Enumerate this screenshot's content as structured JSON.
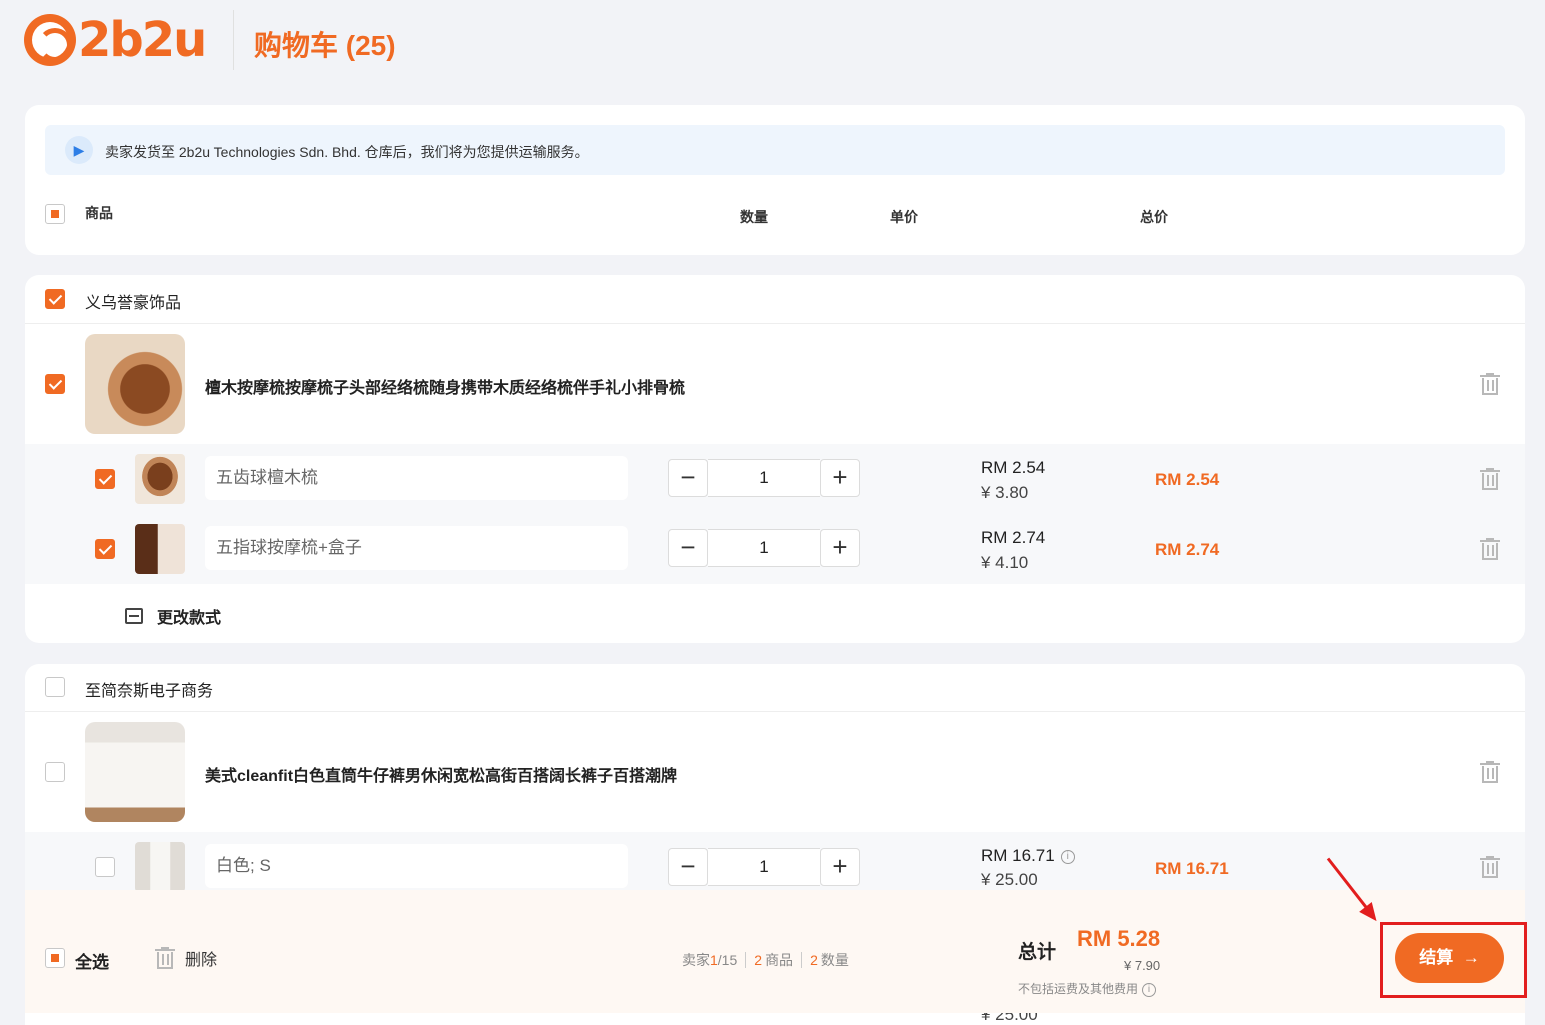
{
  "header": {
    "logo_text": "2b2u",
    "title": "购物车 (25)"
  },
  "notice": {
    "text": "卖家发货至 2b2u Technologies Sdn. Bhd. 仓库后，我们将为您提供运输服务。"
  },
  "table_headers": {
    "product": "商品",
    "quantity": "数量",
    "unit_price": "单价",
    "total": "总价"
  },
  "shops": [
    {
      "name": "义乌誉豪饰品",
      "checked": true,
      "product_title": "檀木按摩梳按摩梳子头部经络梳随身携带木质经络梳伴手礼小排骨梳",
      "skus": [
        {
          "name": "五齿球檀木梳",
          "qty": "1",
          "price_rm": "RM 2.54",
          "price_cny": "¥ 3.80",
          "total_rm": "RM 2.54",
          "checked": true
        },
        {
          "name": "五指球按摩梳+盒子",
          "qty": "1",
          "price_rm": "RM 2.74",
          "price_cny": "¥ 4.10",
          "total_rm": "RM 2.74",
          "checked": true
        }
      ],
      "change_style_label": "更改款式"
    },
    {
      "name": "至简奈斯电子商务",
      "checked": false,
      "product_title": "美式cleanfit白色直筒牛仔裤男休闲宽松高街百搭阔长裤子百搭潮牌",
      "skus": [
        {
          "name": "白色; S",
          "qty": "1",
          "price_rm": "RM 16.71",
          "price_cny": "¥ 25.00",
          "total_rm": "RM 16.71",
          "checked": false
        }
      ],
      "peek_price_cny": "¥ 25.00"
    }
  ],
  "footer": {
    "select_all": "全选",
    "delete": "删除",
    "stats": {
      "seller_label": "卖家",
      "seller_selected": "1",
      "seller_total": "/15",
      "items_count": "2",
      "items_label": "商品",
      "qty_count": "2",
      "qty_label": "数量"
    },
    "total_label": "总计",
    "total_rm": "RM 5.28",
    "total_cny": "¥ 7.90",
    "note": "不包括运费及其他费用",
    "checkout": "结算"
  },
  "colors": {
    "accent": "#f06a23",
    "annotation": "#e21e1e"
  }
}
